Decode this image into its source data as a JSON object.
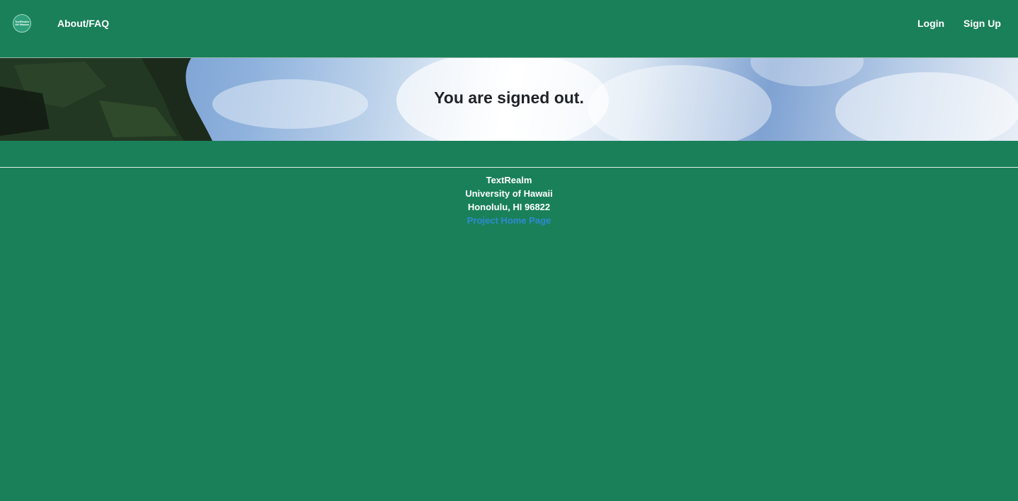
{
  "navbar": {
    "logo_text_line1": "TextRealm",
    "logo_text_line2": "UH Manoa",
    "about_label": "About/FAQ",
    "login_label": "Login",
    "signup_label": "Sign Up"
  },
  "banner": {
    "message": "You are signed out."
  },
  "footer": {
    "name": "TextRealm",
    "university": "University of Hawaii",
    "address": "Honolulu, HI 96822",
    "project_link_label": "Project Home Page"
  },
  "colors": {
    "background": "#1a805a",
    "text": "#ffffff",
    "link": "#2f8ad2",
    "banner_text": "#1f2328"
  }
}
